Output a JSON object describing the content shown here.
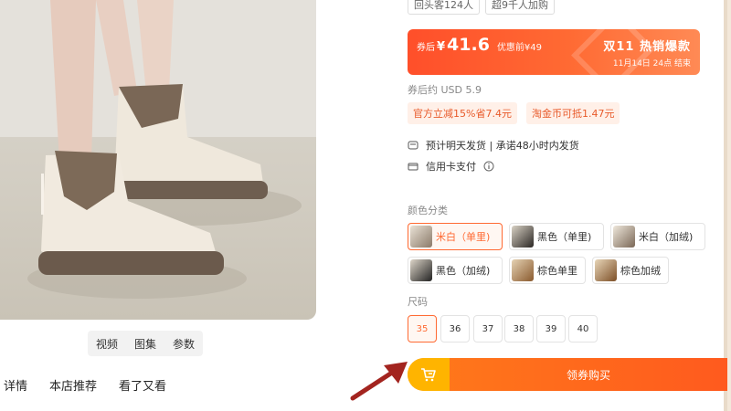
{
  "media_tabs": [
    "视频",
    "图集",
    "参数"
  ],
  "bottom_tabs": [
    "详情",
    "本店推荐",
    "看了又看"
  ],
  "top_badges": [
    "回头客124人",
    "超9千人加购"
  ],
  "promo": {
    "label": "券后",
    "currency": "¥",
    "price": "41.6",
    "before": "优惠前¥49",
    "event": "双11 热销爆款",
    "event_date": "11月14日 24点 结束"
  },
  "usd": "券后约 USD 5.9",
  "discounts": [
    "官方立减15%省7.4元",
    "淘金币可抵1.47元"
  ],
  "services": [
    {
      "icon": "truck-icon",
      "text": "预计明天发货 | 承诺48小时内发货"
    },
    {
      "icon": "credit-card-icon",
      "text": "信用卡支付"
    }
  ],
  "color_label": "颜色分类",
  "colors": [
    {
      "label": "米白（单里)",
      "selected": true
    },
    {
      "label": "黑色（单里)",
      "selected": false
    },
    {
      "label": "米白（加绒)",
      "selected": false
    },
    {
      "label": "黑色（加绒)",
      "selected": false
    },
    {
      "label": "棕色单里",
      "selected": false
    },
    {
      "label": "棕色加绒",
      "selected": false
    }
  ],
  "size_label": "尺码",
  "sizes": [
    "35",
    "36",
    "37",
    "38",
    "39",
    "40"
  ],
  "selected_size": "35",
  "buy_label": "领券购买",
  "colors_theme": {
    "accent": "#ff6a33",
    "promo": "#ff4f2a",
    "cart": "#ffb400",
    "arrow": "#a3241f"
  }
}
